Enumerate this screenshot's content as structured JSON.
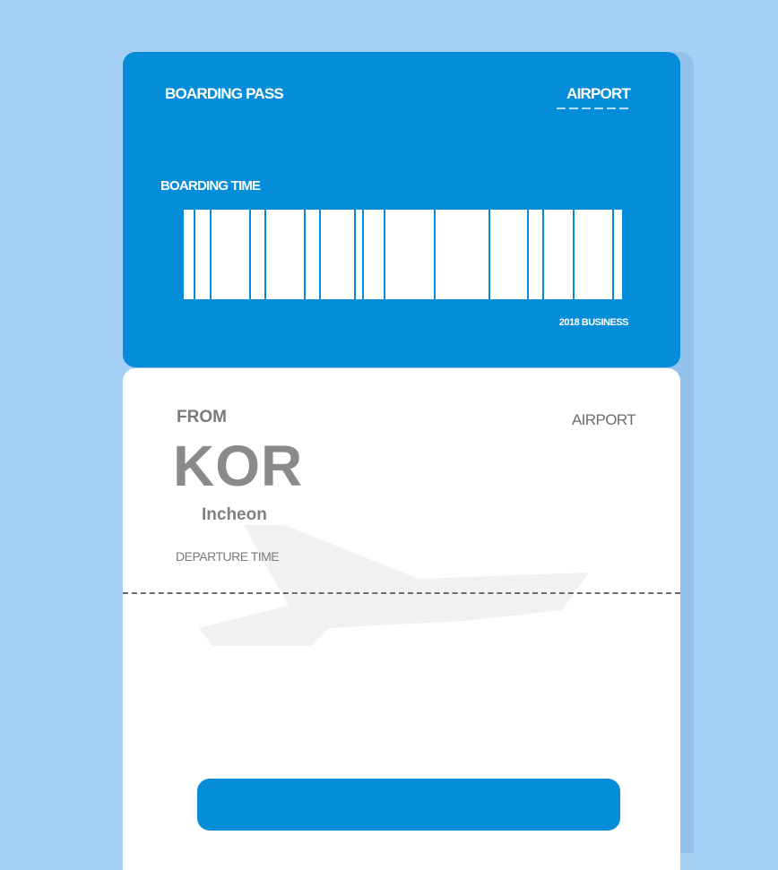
{
  "ticket": {
    "header": {
      "title": "BOARDING PASS",
      "airport": "AIRPORT",
      "boarding_time_label": "BOARDING TIME",
      "class_label": "2018 BUSINESS"
    },
    "details": {
      "from_label": "FROM",
      "airport_label": "AIRPORT",
      "code": "KOR",
      "city": "Incheon",
      "departure_time_label": "DEPARTURE TIME"
    },
    "action_button_label": ""
  },
  "colors": {
    "background": "#a3d0f4",
    "brand_blue": "#058dd9",
    "card_white": "#ffffff"
  },
  "icons": {
    "plane": "airplane-silhouette-icon",
    "barcode": "barcode-icon"
  }
}
